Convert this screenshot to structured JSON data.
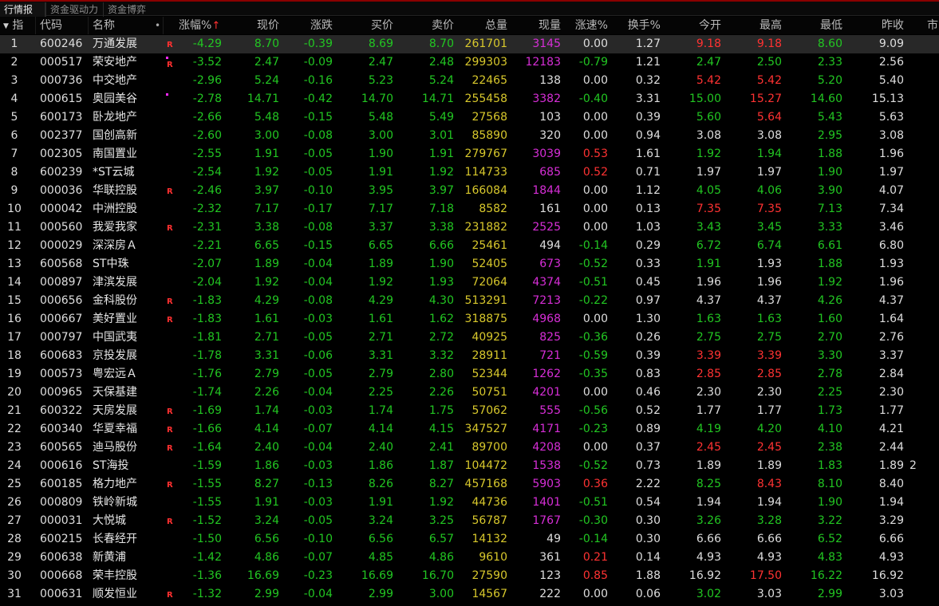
{
  "tabs": [
    "行情报价",
    "资金驱动力",
    "资金博弈"
  ],
  "columns": {
    "index": "指",
    "code": "代码",
    "name": "名称",
    "pct_change": "涨幅%",
    "price": "现价",
    "change": "涨跌",
    "bid": "买价",
    "ask": "卖价",
    "volume": "总量",
    "current_volume": "现量",
    "speed": "涨速%",
    "turnover": "换手%",
    "open": "今开",
    "high": "最高",
    "low": "最低",
    "prev_close": "昨收",
    "more": "市"
  },
  "colors": {
    "up": "#ff3232",
    "down": "#22c622",
    "flat": "#dedede",
    "volume": "#d8c82c",
    "sell_current": "#d72ed7",
    "selected_row": "#282828"
  },
  "rows": [
    {
      "idx": "1",
      "code": "600246",
      "name": "万通发展",
      "flag": "R",
      "pct": "-4.29",
      "price": "8.70",
      "chg": "-0.39",
      "bid": "8.69",
      "ask": "8.70",
      "vol": "261701",
      "cur": "3145",
      "cur_color": "mag",
      "spd": "0.00",
      "spd_color": "flat",
      "turn": "1.27",
      "open": "9.18",
      "open_color": "pos",
      "high": "9.18",
      "high_color": "pos",
      "low": "8.60",
      "low_color": "neg",
      "prev": "9.09",
      "more": ""
    },
    {
      "idx": "2",
      "code": "000517",
      "name": "荣安地产",
      "flag": "R",
      "dot": true,
      "pct": "-3.52",
      "price": "2.47",
      "chg": "-0.09",
      "bid": "2.47",
      "ask": "2.48",
      "vol": "299303",
      "cur": "12183",
      "cur_color": "mag",
      "spd": "-0.79",
      "spd_color": "neg",
      "turn": "1.21",
      "open": "2.47",
      "open_color": "neg",
      "high": "2.50",
      "high_color": "neg",
      "low": "2.33",
      "low_color": "neg",
      "prev": "2.56",
      "more": ""
    },
    {
      "idx": "3",
      "code": "000736",
      "name": "中交地产",
      "flag": "",
      "pct": "-2.96",
      "price": "5.24",
      "chg": "-0.16",
      "bid": "5.23",
      "ask": "5.24",
      "vol": "22465",
      "cur": "138",
      "cur_color": "wht",
      "spd": "0.00",
      "spd_color": "flat",
      "turn": "0.32",
      "open": "5.42",
      "open_color": "pos",
      "high": "5.42",
      "high_color": "pos",
      "low": "5.20",
      "low_color": "neg",
      "prev": "5.40",
      "more": ""
    },
    {
      "idx": "4",
      "code": "000615",
      "name": "奥园美谷",
      "flag": "",
      "dot": true,
      "pct": "-2.78",
      "price": "14.71",
      "chg": "-0.42",
      "bid": "14.70",
      "ask": "14.71",
      "vol": "255458",
      "cur": "3382",
      "cur_color": "mag",
      "spd": "-0.40",
      "spd_color": "neg",
      "turn": "3.31",
      "open": "15.00",
      "open_color": "neg",
      "high": "15.27",
      "high_color": "pos",
      "low": "14.60",
      "low_color": "neg",
      "prev": "15.13",
      "more": ""
    },
    {
      "idx": "5",
      "code": "600173",
      "name": "卧龙地产",
      "flag": "",
      "pct": "-2.66",
      "price": "5.48",
      "chg": "-0.15",
      "bid": "5.48",
      "ask": "5.49",
      "vol": "27568",
      "cur": "103",
      "cur_color": "wht",
      "spd": "0.00",
      "spd_color": "flat",
      "turn": "0.39",
      "open": "5.60",
      "open_color": "neg",
      "high": "5.64",
      "high_color": "pos",
      "low": "5.43",
      "low_color": "neg",
      "prev": "5.63",
      "more": ""
    },
    {
      "idx": "6",
      "code": "002377",
      "name": "国创高新",
      "flag": "",
      "pct": "-2.60",
      "price": "3.00",
      "chg": "-0.08",
      "bid": "3.00",
      "ask": "3.01",
      "vol": "85890",
      "cur": "320",
      "cur_color": "wht",
      "spd": "0.00",
      "spd_color": "flat",
      "turn": "0.94",
      "open": "3.08",
      "open_color": "flat",
      "high": "3.08",
      "high_color": "flat",
      "low": "2.95",
      "low_color": "neg",
      "prev": "3.08",
      "more": ""
    },
    {
      "idx": "7",
      "code": "002305",
      "name": "南国置业",
      "flag": "",
      "pct": "-2.55",
      "price": "1.91",
      "chg": "-0.05",
      "bid": "1.90",
      "ask": "1.91",
      "vol": "279767",
      "cur": "3039",
      "cur_color": "mag",
      "spd": "0.53",
      "spd_color": "pos",
      "turn": "1.61",
      "open": "1.92",
      "open_color": "neg",
      "high": "1.94",
      "high_color": "neg",
      "low": "1.88",
      "low_color": "neg",
      "prev": "1.96",
      "more": ""
    },
    {
      "idx": "8",
      "code": "600239",
      "name": "*ST云城",
      "flag": "",
      "pct": "-2.54",
      "price": "1.92",
      "chg": "-0.05",
      "bid": "1.91",
      "ask": "1.92",
      "vol": "114733",
      "cur": "685",
      "cur_color": "mag",
      "spd": "0.52",
      "spd_color": "pos",
      "turn": "0.71",
      "open": "1.97",
      "open_color": "flat",
      "high": "1.97",
      "high_color": "flat",
      "low": "1.90",
      "low_color": "neg",
      "prev": "1.97",
      "more": ""
    },
    {
      "idx": "9",
      "code": "000036",
      "name": "华联控股",
      "flag": "R",
      "pct": "-2.46",
      "price": "3.97",
      "chg": "-0.10",
      "bid": "3.95",
      "ask": "3.97",
      "vol": "166084",
      "cur": "1844",
      "cur_color": "mag",
      "spd": "0.00",
      "spd_color": "flat",
      "turn": "1.12",
      "open": "4.05",
      "open_color": "neg",
      "high": "4.06",
      "high_color": "neg",
      "low": "3.90",
      "low_color": "neg",
      "prev": "4.07",
      "more": ""
    },
    {
      "idx": "10",
      "code": "000042",
      "name": "中洲控股",
      "flag": "",
      "pct": "-2.32",
      "price": "7.17",
      "chg": "-0.17",
      "bid": "7.17",
      "ask": "7.18",
      "vol": "8582",
      "cur": "161",
      "cur_color": "wht",
      "spd": "0.00",
      "spd_color": "flat",
      "turn": "0.13",
      "open": "7.35",
      "open_color": "pos",
      "high": "7.35",
      "high_color": "pos",
      "low": "7.13",
      "low_color": "neg",
      "prev": "7.34",
      "more": ""
    },
    {
      "idx": "11",
      "code": "000560",
      "name": "我爱我家",
      "flag": "R",
      "pct": "-2.31",
      "price": "3.38",
      "chg": "-0.08",
      "bid": "3.37",
      "ask": "3.38",
      "vol": "231882",
      "cur": "2525",
      "cur_color": "mag",
      "spd": "0.00",
      "spd_color": "flat",
      "turn": "1.03",
      "open": "3.43",
      "open_color": "neg",
      "high": "3.45",
      "high_color": "neg",
      "low": "3.33",
      "low_color": "neg",
      "prev": "3.46",
      "more": ""
    },
    {
      "idx": "12",
      "code": "000029",
      "name": "深深房Ａ",
      "flag": "",
      "pct": "-2.21",
      "price": "6.65",
      "chg": "-0.15",
      "bid": "6.65",
      "ask": "6.66",
      "vol": "25461",
      "cur": "494",
      "cur_color": "wht",
      "spd": "-0.14",
      "spd_color": "neg",
      "turn": "0.29",
      "open": "6.72",
      "open_color": "neg",
      "high": "6.74",
      "high_color": "neg",
      "low": "6.61",
      "low_color": "neg",
      "prev": "6.80",
      "more": ""
    },
    {
      "idx": "13",
      "code": "600568",
      "name": "ST中珠",
      "flag": "",
      "pct": "-2.07",
      "price": "1.89",
      "chg": "-0.04",
      "bid": "1.89",
      "ask": "1.90",
      "vol": "52405",
      "cur": "673",
      "cur_color": "mag",
      "spd": "-0.52",
      "spd_color": "neg",
      "turn": "0.33",
      "open": "1.91",
      "open_color": "neg",
      "high": "1.93",
      "high_color": "flat",
      "low": "1.88",
      "low_color": "neg",
      "prev": "1.93",
      "more": ""
    },
    {
      "idx": "14",
      "code": "000897",
      "name": "津滨发展",
      "flag": "",
      "pct": "-2.04",
      "price": "1.92",
      "chg": "-0.04",
      "bid": "1.92",
      "ask": "1.93",
      "vol": "72064",
      "cur": "4374",
      "cur_color": "mag",
      "spd": "-0.51",
      "spd_color": "neg",
      "turn": "0.45",
      "open": "1.96",
      "open_color": "flat",
      "high": "1.96",
      "high_color": "flat",
      "low": "1.92",
      "low_color": "neg",
      "prev": "1.96",
      "more": ""
    },
    {
      "idx": "15",
      "code": "000656",
      "name": "金科股份",
      "flag": "R",
      "pct": "-1.83",
      "price": "4.29",
      "chg": "-0.08",
      "bid": "4.29",
      "ask": "4.30",
      "vol": "513291",
      "cur": "7213",
      "cur_color": "mag",
      "spd": "-0.22",
      "spd_color": "neg",
      "turn": "0.97",
      "open": "4.37",
      "open_color": "flat",
      "high": "4.37",
      "high_color": "flat",
      "low": "4.26",
      "low_color": "neg",
      "prev": "4.37",
      "more": ""
    },
    {
      "idx": "16",
      "code": "000667",
      "name": "美好置业",
      "flag": "R",
      "pct": "-1.83",
      "price": "1.61",
      "chg": "-0.03",
      "bid": "1.61",
      "ask": "1.62",
      "vol": "318875",
      "cur": "4968",
      "cur_color": "mag",
      "spd": "0.00",
      "spd_color": "flat",
      "turn": "1.30",
      "open": "1.63",
      "open_color": "neg",
      "high": "1.63",
      "high_color": "neg",
      "low": "1.60",
      "low_color": "neg",
      "prev": "1.64",
      "more": ""
    },
    {
      "idx": "17",
      "code": "000797",
      "name": "中国武夷",
      "flag": "",
      "pct": "-1.81",
      "price": "2.71",
      "chg": "-0.05",
      "bid": "2.71",
      "ask": "2.72",
      "vol": "40925",
      "cur": "825",
      "cur_color": "mag",
      "spd": "-0.36",
      "spd_color": "neg",
      "turn": "0.26",
      "open": "2.75",
      "open_color": "neg",
      "high": "2.75",
      "high_color": "neg",
      "low": "2.70",
      "low_color": "neg",
      "prev": "2.76",
      "more": ""
    },
    {
      "idx": "18",
      "code": "600683",
      "name": "京投发展",
      "flag": "",
      "pct": "-1.78",
      "price": "3.31",
      "chg": "-0.06",
      "bid": "3.31",
      "ask": "3.32",
      "vol": "28911",
      "cur": "721",
      "cur_color": "mag",
      "spd": "-0.59",
      "spd_color": "neg",
      "turn": "0.39",
      "open": "3.39",
      "open_color": "pos",
      "high": "3.39",
      "high_color": "pos",
      "low": "3.30",
      "low_color": "neg",
      "prev": "3.37",
      "more": ""
    },
    {
      "idx": "19",
      "code": "000573",
      "name": "粤宏远Ａ",
      "flag": "",
      "pct": "-1.76",
      "price": "2.79",
      "chg": "-0.05",
      "bid": "2.79",
      "ask": "2.80",
      "vol": "52344",
      "cur": "1262",
      "cur_color": "mag",
      "spd": "-0.35",
      "spd_color": "neg",
      "turn": "0.83",
      "open": "2.85",
      "open_color": "pos",
      "high": "2.85",
      "high_color": "pos",
      "low": "2.78",
      "low_color": "neg",
      "prev": "2.84",
      "more": ""
    },
    {
      "idx": "20",
      "code": "000965",
      "name": "天保基建",
      "flag": "",
      "pct": "-1.74",
      "price": "2.26",
      "chg": "-0.04",
      "bid": "2.25",
      "ask": "2.26",
      "vol": "50751",
      "cur": "4201",
      "cur_color": "mag",
      "spd": "0.00",
      "spd_color": "flat",
      "turn": "0.46",
      "open": "2.30",
      "open_color": "flat",
      "high": "2.30",
      "high_color": "flat",
      "low": "2.25",
      "low_color": "neg",
      "prev": "2.30",
      "more": ""
    },
    {
      "idx": "21",
      "code": "600322",
      "name": "天房发展",
      "flag": "R",
      "pct": "-1.69",
      "price": "1.74",
      "chg": "-0.03",
      "bid": "1.74",
      "ask": "1.75",
      "vol": "57062",
      "cur": "555",
      "cur_color": "mag",
      "spd": "-0.56",
      "spd_color": "neg",
      "turn": "0.52",
      "open": "1.77",
      "open_color": "flat",
      "high": "1.77",
      "high_color": "flat",
      "low": "1.73",
      "low_color": "neg",
      "prev": "1.77",
      "more": ""
    },
    {
      "idx": "22",
      "code": "600340",
      "name": "华夏幸福",
      "flag": "R",
      "pct": "-1.66",
      "price": "4.14",
      "chg": "-0.07",
      "bid": "4.14",
      "ask": "4.15",
      "vol": "347527",
      "cur": "4171",
      "cur_color": "mag",
      "spd": "-0.23",
      "spd_color": "neg",
      "turn": "0.89",
      "open": "4.19",
      "open_color": "neg",
      "high": "4.20",
      "high_color": "neg",
      "low": "4.10",
      "low_color": "neg",
      "prev": "4.21",
      "more": ""
    },
    {
      "idx": "23",
      "code": "600565",
      "name": "迪马股份",
      "flag": "R",
      "pct": "-1.64",
      "price": "2.40",
      "chg": "-0.04",
      "bid": "2.40",
      "ask": "2.41",
      "vol": "89700",
      "cur": "4208",
      "cur_color": "mag",
      "spd": "0.00",
      "spd_color": "flat",
      "turn": "0.37",
      "open": "2.45",
      "open_color": "pos",
      "high": "2.45",
      "high_color": "pos",
      "low": "2.38",
      "low_color": "neg",
      "prev": "2.44",
      "more": ""
    },
    {
      "idx": "24",
      "code": "000616",
      "name": "ST海投",
      "flag": "",
      "pct": "-1.59",
      "price": "1.86",
      "chg": "-0.03",
      "bid": "1.86",
      "ask": "1.87",
      "vol": "104472",
      "cur": "1538",
      "cur_color": "mag",
      "spd": "-0.52",
      "spd_color": "neg",
      "turn": "0.73",
      "open": "1.89",
      "open_color": "flat",
      "high": "1.89",
      "high_color": "flat",
      "low": "1.83",
      "low_color": "neg",
      "prev": "1.89",
      "more": "2"
    },
    {
      "idx": "25",
      "code": "600185",
      "name": "格力地产",
      "flag": "R",
      "pct": "-1.55",
      "price": "8.27",
      "chg": "-0.13",
      "bid": "8.26",
      "ask": "8.27",
      "vol": "457168",
      "cur": "5903",
      "cur_color": "mag",
      "spd": "0.36",
      "spd_color": "pos",
      "turn": "2.22",
      "open": "8.25",
      "open_color": "neg",
      "high": "8.43",
      "high_color": "pos",
      "low": "8.10",
      "low_color": "neg",
      "prev": "8.40",
      "more": ""
    },
    {
      "idx": "26",
      "code": "000809",
      "name": "铁岭新城",
      "flag": "",
      "pct": "-1.55",
      "price": "1.91",
      "chg": "-0.03",
      "bid": "1.91",
      "ask": "1.92",
      "vol": "44736",
      "cur": "1401",
      "cur_color": "mag",
      "spd": "-0.51",
      "spd_color": "neg",
      "turn": "0.54",
      "open": "1.94",
      "open_color": "flat",
      "high": "1.94",
      "high_color": "flat",
      "low": "1.90",
      "low_color": "neg",
      "prev": "1.94",
      "more": ""
    },
    {
      "idx": "27",
      "code": "000031",
      "name": "大悦城",
      "flag": "R",
      "pct": "-1.52",
      "price": "3.24",
      "chg": "-0.05",
      "bid": "3.24",
      "ask": "3.25",
      "vol": "56787",
      "cur": "1767",
      "cur_color": "mag",
      "spd": "-0.30",
      "spd_color": "neg",
      "turn": "0.30",
      "open": "3.26",
      "open_color": "neg",
      "high": "3.28",
      "high_color": "neg",
      "low": "3.22",
      "low_color": "neg",
      "prev": "3.29",
      "more": ""
    },
    {
      "idx": "28",
      "code": "600215",
      "name": "长春经开",
      "flag": "",
      "pct": "-1.50",
      "price": "6.56",
      "chg": "-0.10",
      "bid": "6.56",
      "ask": "6.57",
      "vol": "14132",
      "cur": "49",
      "cur_color": "wht",
      "spd": "-0.14",
      "spd_color": "neg",
      "turn": "0.30",
      "open": "6.66",
      "open_color": "flat",
      "high": "6.66",
      "high_color": "flat",
      "low": "6.52",
      "low_color": "neg",
      "prev": "6.66",
      "more": ""
    },
    {
      "idx": "29",
      "code": "600638",
      "name": "新黄浦",
      "flag": "",
      "pct": "-1.42",
      "price": "4.86",
      "chg": "-0.07",
      "bid": "4.85",
      "ask": "4.86",
      "vol": "9610",
      "cur": "361",
      "cur_color": "wht",
      "spd": "0.21",
      "spd_color": "pos",
      "turn": "0.14",
      "open": "4.93",
      "open_color": "flat",
      "high": "4.93",
      "high_color": "flat",
      "low": "4.83",
      "low_color": "neg",
      "prev": "4.93",
      "more": ""
    },
    {
      "idx": "30",
      "code": "000668",
      "name": "荣丰控股",
      "flag": "",
      "pct": "-1.36",
      "price": "16.69",
      "chg": "-0.23",
      "bid": "16.69",
      "ask": "16.70",
      "vol": "27590",
      "cur": "123",
      "cur_color": "wht",
      "spd": "0.85",
      "spd_color": "pos",
      "turn": "1.88",
      "open": "16.92",
      "open_color": "flat",
      "high": "17.50",
      "high_color": "pos",
      "low": "16.22",
      "low_color": "neg",
      "prev": "16.92",
      "more": ""
    },
    {
      "idx": "31",
      "code": "000631",
      "name": "顺发恒业",
      "flag": "R",
      "pct": "-1.32",
      "price": "2.99",
      "chg": "-0.04",
      "bid": "2.99",
      "ask": "3.00",
      "vol": "14567",
      "cur": "222",
      "cur_color": "wht",
      "spd": "0.00",
      "spd_color": "flat",
      "turn": "0.06",
      "open": "3.02",
      "open_color": "neg",
      "high": "3.03",
      "high_color": "flat",
      "low": "2.99",
      "low_color": "neg",
      "prev": "3.03",
      "more": ""
    }
  ]
}
